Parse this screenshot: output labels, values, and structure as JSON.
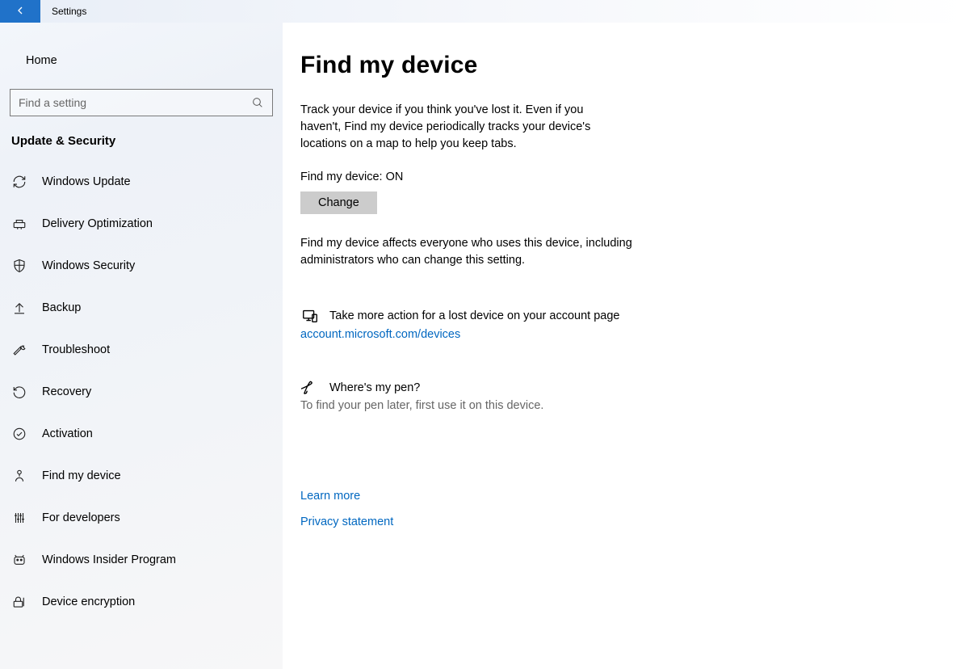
{
  "titlebar": {
    "app_name": "Settings"
  },
  "sidebar": {
    "home_label": "Home",
    "search_placeholder": "Find a setting",
    "section_heading": "Update & Security",
    "items": [
      {
        "label": "Windows Update"
      },
      {
        "label": "Delivery Optimization"
      },
      {
        "label": "Windows Security"
      },
      {
        "label": "Backup"
      },
      {
        "label": "Troubleshoot"
      },
      {
        "label": "Recovery"
      },
      {
        "label": "Activation"
      },
      {
        "label": "Find my device"
      },
      {
        "label": "For developers"
      },
      {
        "label": "Windows Insider Program"
      },
      {
        "label": "Device encryption"
      }
    ]
  },
  "main": {
    "title": "Find my device",
    "description": "Track your device if you think you've lost it. Even if you haven't, Find my device periodically tracks your device's locations on a map to help you keep tabs.",
    "status_label": "Find my device: ON",
    "change_button": "Change",
    "affects_text": "Find my device affects everyone who uses this device, including administrators who can change this setting.",
    "account_action_text": "Take more action for a lost device on your account page",
    "account_link": "account.microsoft.com/devices",
    "pen_heading": "Where's my pen?",
    "pen_body": "To find your pen later, first use it on this device.",
    "learn_more": "Learn more",
    "privacy": "Privacy statement"
  }
}
